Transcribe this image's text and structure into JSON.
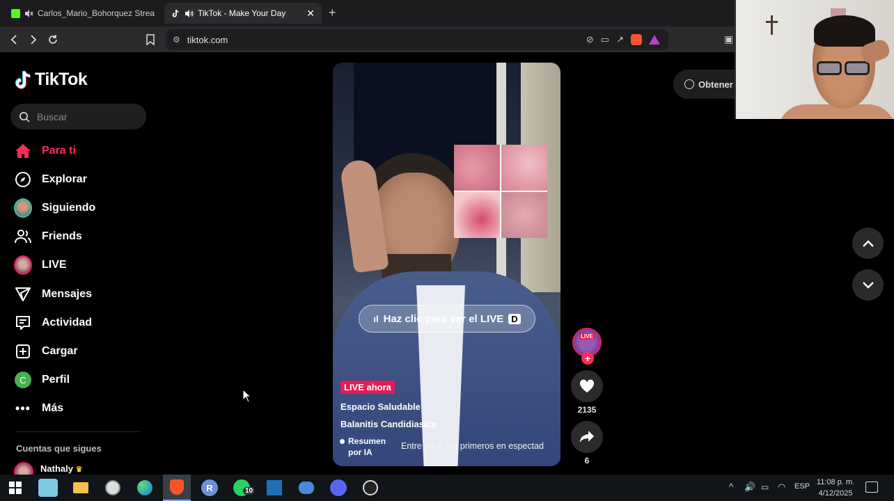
{
  "browser": {
    "tabs": [
      {
        "label": "Carlos_Mario_Bohorquez Stream"
      },
      {
        "label": "TikTok - Make Your Day"
      }
    ],
    "url": "tiktok.com"
  },
  "tiktok": {
    "logo": "TikTok",
    "search_placeholder": "Buscar",
    "nav": [
      {
        "label": "Para ti",
        "icon": "home-icon",
        "active": true
      },
      {
        "label": "Explorar",
        "icon": "compass-icon"
      },
      {
        "label": "Siguiendo",
        "icon": "avatar-icon"
      },
      {
        "label": "Friends",
        "icon": "friends-icon"
      },
      {
        "label": "LIVE",
        "icon": "live-avatar-icon"
      },
      {
        "label": "Mensajes",
        "icon": "send-icon"
      },
      {
        "label": "Actividad",
        "icon": "activity-icon"
      },
      {
        "label": "Cargar",
        "icon": "upload-icon"
      },
      {
        "label": "Perfil",
        "icon": "profile-icon"
      },
      {
        "label": "Más",
        "icon": "more-icon"
      }
    ],
    "profile_initial": "C",
    "following_header": "Cuentas que sigues",
    "following": [
      {
        "name": "Nathaly"
      }
    ],
    "get_app": "Obtener",
    "video": {
      "cta": "Haz clic para ver el LIVE",
      "cta_key": "D",
      "live_badge": "LIVE ahora",
      "title": "Espacio Saludable",
      "subtitle": "Balanitis Candidiasica",
      "summary": "Resumen por IA",
      "rank": "Entre los 0.1% primeros en espectad"
    },
    "actions": {
      "live_label": "LIVE",
      "likes": "2135",
      "shares": "6"
    }
  },
  "taskbar": {
    "lang": "ESP",
    "time": "11:08 p. m.",
    "date": "4/12/2025",
    "whatsapp_badge": "10"
  },
  "colors": {
    "accent": "#fe2c55",
    "live_pink": "#e51c5a",
    "background": "#000000"
  }
}
